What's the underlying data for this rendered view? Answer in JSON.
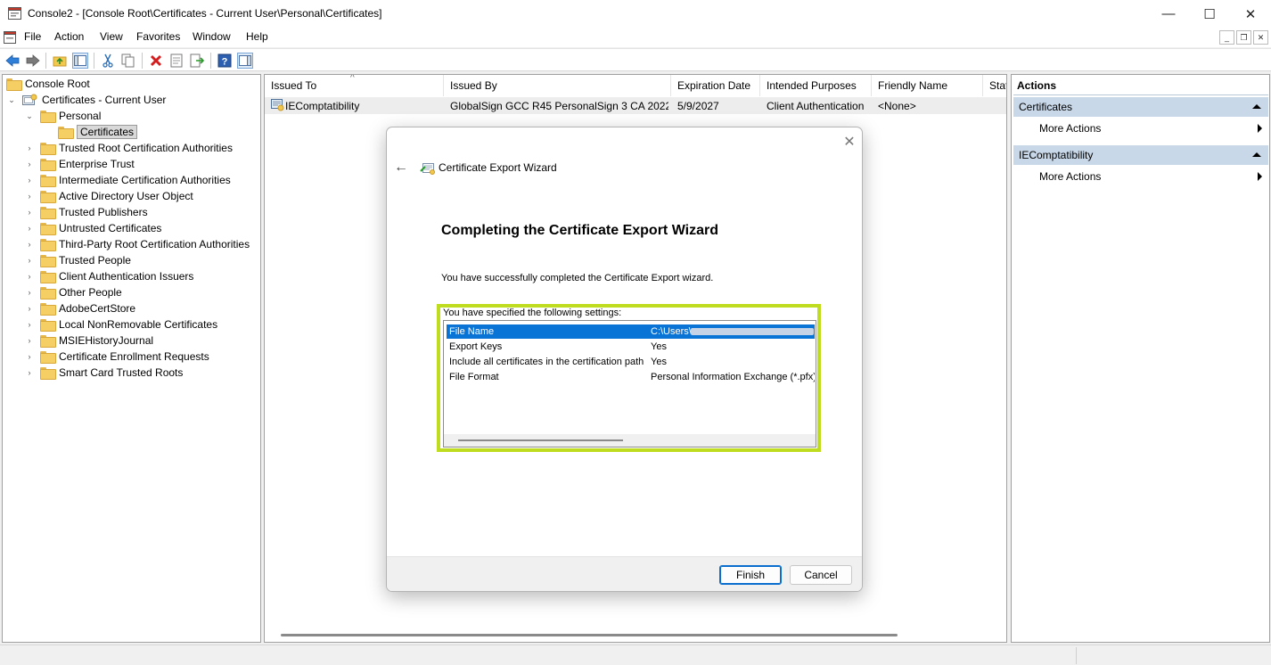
{
  "window": {
    "title": "Console2 - [Console Root\\Certificates - Current User\\Personal\\Certificates]",
    "minimize_glyph": "—",
    "maximize_glyph": "☐",
    "close_glyph": "✕"
  },
  "menu": {
    "items": [
      "File",
      "Action",
      "View",
      "Favorites",
      "Window",
      "Help"
    ]
  },
  "toolbar": {
    "icons": [
      "back-arrow-icon",
      "forward-arrow-icon",
      "up-folder-icon",
      "show-hide-tree-icon",
      "cut-icon",
      "copy-icon",
      "delete-icon",
      "properties-icon",
      "export-list-icon",
      "help-icon",
      "show-hide-action-pane-icon"
    ]
  },
  "tree": {
    "root": "Console Root",
    "store": "Certificates - Current User",
    "personal": "Personal",
    "certificates": "Certificates",
    "folders": [
      "Trusted Root Certification Authorities",
      "Enterprise Trust",
      "Intermediate Certification Authorities",
      "Active Directory User Object",
      "Trusted Publishers",
      "Untrusted Certificates",
      "Third-Party Root Certification Authorities",
      "Trusted People",
      "Client Authentication Issuers",
      "Other People",
      "AdobeCertStore",
      "Local NonRemovable Certificates",
      "MSIEHistoryJournal",
      "Certificate Enrollment Requests",
      "Smart Card Trusted Roots"
    ]
  },
  "list": {
    "columns": [
      "Issued To",
      "Issued By",
      "Expiration Date",
      "Intended Purposes",
      "Friendly Name",
      "Stat"
    ],
    "rows": [
      {
        "issued_to": "IEComptatibility",
        "issued_by": "GlobalSign GCC R45 PersonalSign 3 CA 2022…",
        "expiration": "5/9/2027",
        "purposes": "Client Authentication",
        "friendly_name": "<None>"
      }
    ]
  },
  "actions": {
    "header": "Actions",
    "sections": [
      {
        "title": "Certificates",
        "item": "More Actions"
      },
      {
        "title": "IEComptatibility",
        "item": "More Actions"
      }
    ]
  },
  "wizard": {
    "title": "Certificate Export Wizard",
    "heading": "Completing the Certificate Export Wizard",
    "message": "You have successfully completed the Certificate Export wizard.",
    "settings_caption": "You have specified the following settings:",
    "settings": [
      {
        "name": "File Name",
        "value": "C:\\Users\\"
      },
      {
        "name": "Export Keys",
        "value": "Yes"
      },
      {
        "name": "Include all certificates in the certification path",
        "value": "Yes"
      },
      {
        "name": "File Format",
        "value": "Personal Information Exchange (*.pfx)"
      }
    ],
    "finish_label": "Finish",
    "cancel_label": "Cancel",
    "highlight_color": "#bfdc1e",
    "selection_color": "#0a74d6"
  }
}
